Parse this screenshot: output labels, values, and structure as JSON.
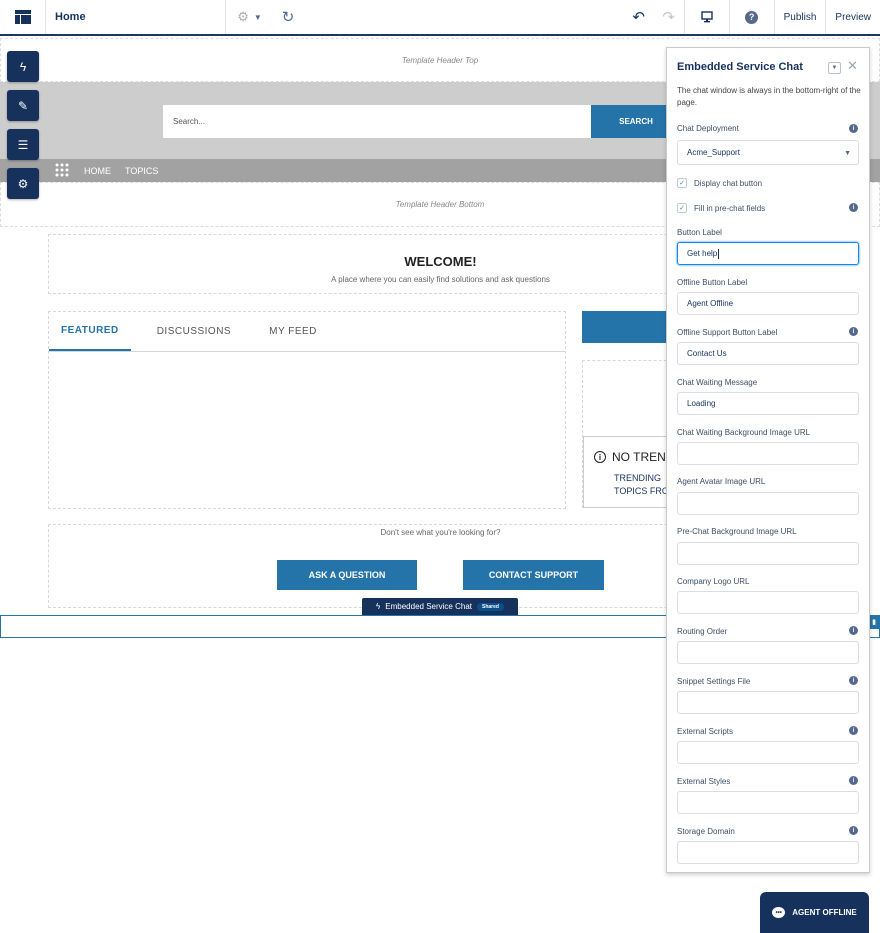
{
  "topbar": {
    "page_name": "Home",
    "publish": "Publish",
    "preview": "Preview"
  },
  "canvas": {
    "header_top": "Template Header Top",
    "search_placeholder": "Search...",
    "search_button": "SEARCH",
    "nav_items": [
      "HOME",
      "TOPICS"
    ],
    "header_bottom": "Template Header Bottom",
    "welcome_title": "WELCOME!",
    "welcome_subtitle": "A place where you can easily find solutions and ask questions",
    "tabs": [
      "FEATURED",
      "DISCUSSIONS",
      "MY FEED"
    ],
    "trending_title": "NO TRENDING",
    "trending_desc_line1": "TRENDING",
    "trending_desc_line2": "TOPICS FROM",
    "ask_prompt": "Don't see what you're looking for?",
    "ask_question": "ASK A QUESTION",
    "contact_support": "CONTACT SUPPORT",
    "component_tag": "Embedded Service Chat",
    "component_shared": "Shared"
  },
  "panel": {
    "title": "Embedded Service Chat",
    "description": "The chat window is always in the bottom-right of the page.",
    "chat_deployment_label": "Chat Deployment",
    "chat_deployment_value": "Acme_Support",
    "display_chat_button": "Display chat button",
    "fill_prechat": "Fill in pre-chat fields",
    "button_label_label": "Button Label",
    "button_label_value": "Get help",
    "offline_button_label": "Offline Button Label",
    "offline_button_value": "Agent Offline",
    "offline_support_label": "Offline Support Button Label",
    "offline_support_value": "Contact Us",
    "chat_waiting_label": "Chat Waiting Message",
    "chat_waiting_value": "Loading",
    "fields": [
      "Chat Waiting Background Image URL",
      "Agent Avatar Image URL",
      "Pre-Chat Background Image URL",
      "Company Logo URL",
      "Routing Order",
      "Snippet Settings File",
      "External Scripts",
      "External Styles",
      "Storage Domain"
    ]
  },
  "chat_button": "AGENT OFFLINE",
  "colors": {
    "navy": "#16325c",
    "brand_blue": "#2574a9",
    "hero_gray": "#cdcdcd",
    "nav_gray": "#a2a2a2"
  },
  "icons": [
    "page-layout-icon",
    "gear-icon",
    "redo-icon",
    "undo-icon",
    "device-icon",
    "help-icon",
    "lightning-icon",
    "brush-icon",
    "list-icon",
    "settings-icon",
    "app-launcher-icon",
    "info-icon",
    "close-icon",
    "chat-icon"
  ]
}
